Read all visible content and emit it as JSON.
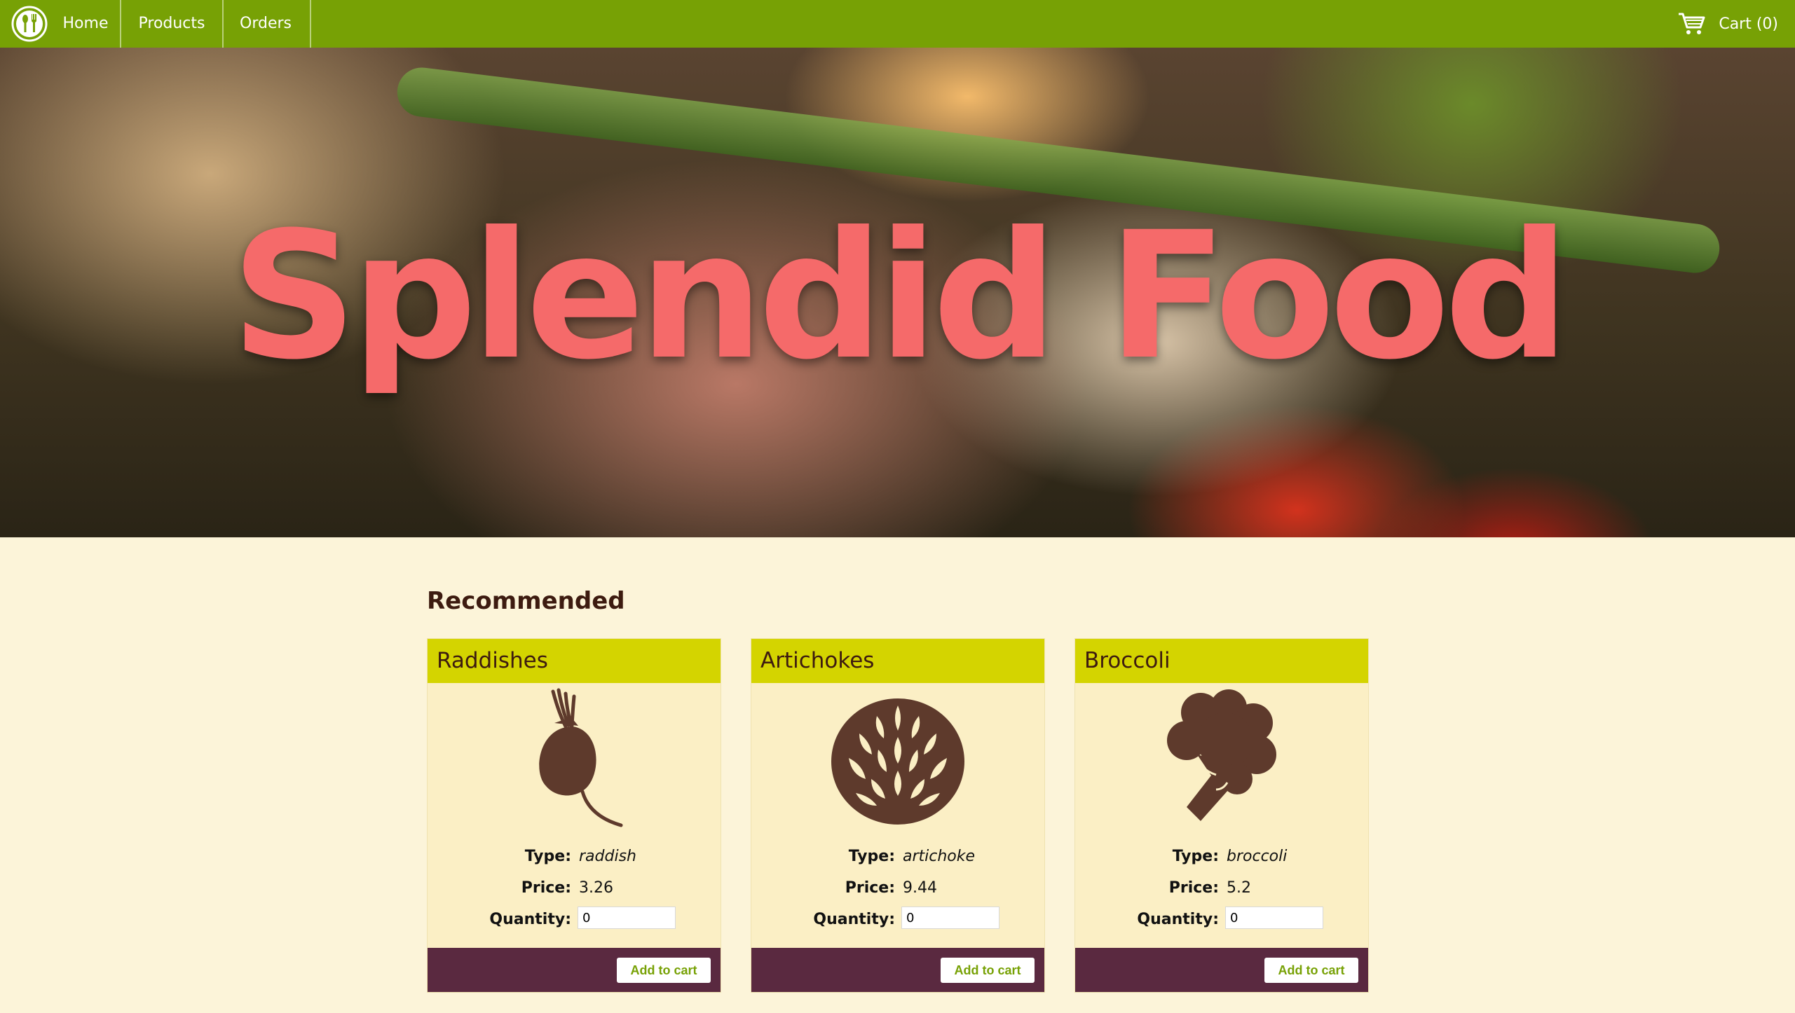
{
  "nav": {
    "items": [
      "Home",
      "Products",
      "Orders"
    ],
    "cart_label": "Cart (0)",
    "logo_icon": "fork-spoon-icon",
    "cart_icon": "shopping-cart-icon"
  },
  "hero": {
    "title": "Splendid Food"
  },
  "main": {
    "section_title": "Recommended",
    "products": [
      {
        "name": "Raddishes",
        "icon": "radish-icon",
        "type_label": "Type:",
        "type": "raddish",
        "price_label": "Price:",
        "price": "3.26",
        "qty_label": "Quantity:",
        "qty": "0",
        "button": "Add to cart"
      },
      {
        "name": "Artichokes",
        "icon": "artichoke-icon",
        "type_label": "Type:",
        "type": "artichoke",
        "price_label": "Price:",
        "price": "9.44",
        "qty_label": "Quantity:",
        "qty": "0",
        "button": "Add to cart"
      },
      {
        "name": "Broccoli",
        "icon": "broccoli-icon",
        "type_label": "Type:",
        "type": "broccoli",
        "price_label": "Price:",
        "price": "5.2",
        "qty_label": "Quantity:",
        "qty": "0",
        "button": "Add to cart"
      }
    ]
  },
  "colors": {
    "nav_bg": "#77a105",
    "page_bg": "#fcf4d9",
    "card_head": "#d4d400",
    "card_body": "#fbefc5",
    "card_foot": "#5a2940",
    "hero_title": "#f56a6a",
    "icon": "#5e3a2c"
  }
}
